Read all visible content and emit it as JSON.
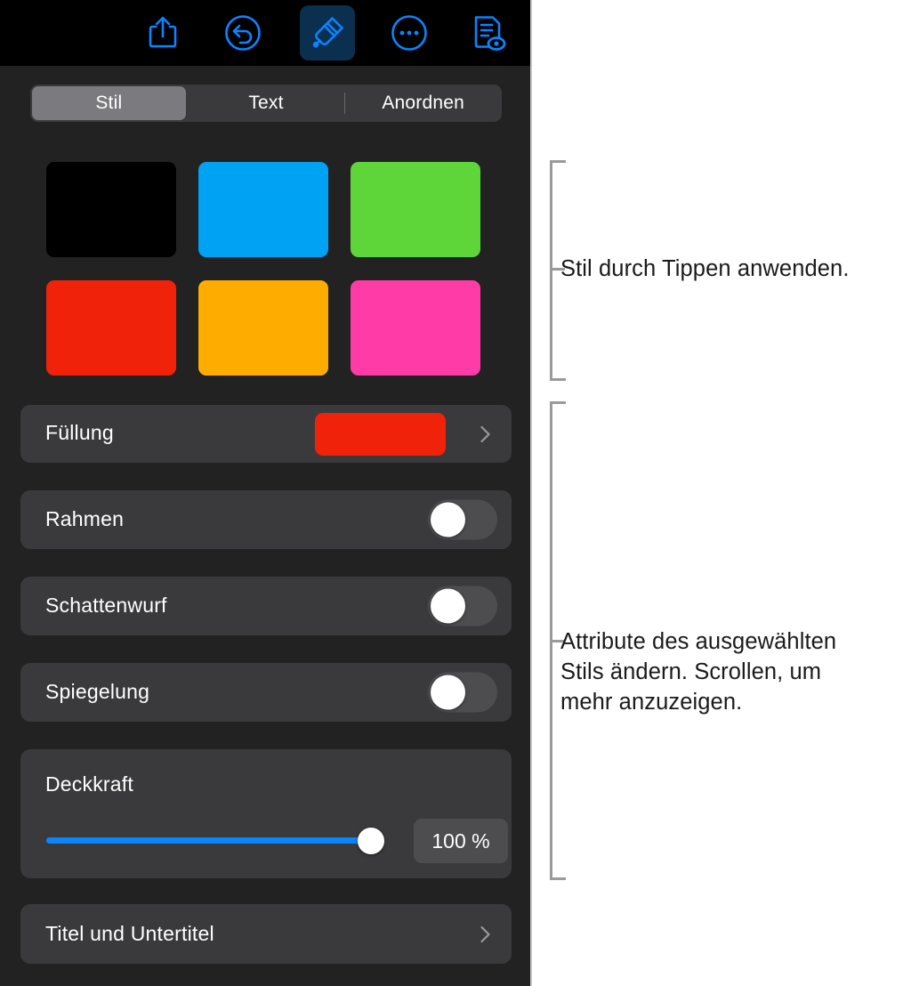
{
  "toolbar": {
    "items": [
      {
        "name": "share-icon",
        "label": "Teilen",
        "active": false
      },
      {
        "name": "undo-icon",
        "label": "Widerrufen",
        "active": false
      },
      {
        "name": "format-brush-icon",
        "label": "Format",
        "active": true
      },
      {
        "name": "more-options-icon",
        "label": "Mehr",
        "active": false
      },
      {
        "name": "document-preview-icon",
        "label": "Dokument",
        "active": false
      }
    ]
  },
  "segmented_control": {
    "tabs": [
      {
        "label": "Stil",
        "selected": true
      },
      {
        "label": "Text",
        "selected": false
      },
      {
        "label": "Anordnen",
        "selected": false
      }
    ]
  },
  "style_swatches": {
    "items": [
      {
        "name": "style-swatch-black",
        "color": "#000000"
      },
      {
        "name": "style-swatch-blue",
        "color": "#00a2f3"
      },
      {
        "name": "style-swatch-green",
        "color": "#5ed63a"
      },
      {
        "name": "style-swatch-red",
        "color": "#f02209"
      },
      {
        "name": "style-swatch-orange",
        "color": "#ffac00"
      },
      {
        "name": "style-swatch-pink",
        "color": "#ff3ba7"
      }
    ]
  },
  "rows": {
    "fill": {
      "label": "Füllung",
      "color": "#f02209"
    },
    "border": {
      "label": "Rahmen",
      "enabled": false
    },
    "shadow": {
      "label": "Schattenwurf",
      "enabled": false
    },
    "reflection": {
      "label": "Spiegelung",
      "enabled": false
    },
    "opacity": {
      "label": "Deckkraft",
      "value": "100 %",
      "percent": 100
    },
    "title_subtitle": {
      "label": "Titel und Untertitel"
    }
  },
  "callouts": {
    "top": "Stil durch Tippen anwenden.",
    "bottom": "Attribute des ausgewählten\nStils ändern. Scrollen, um\nmehr anzuzeigen."
  },
  "colors": {
    "panel_bg": "#222222",
    "toolbar_bg": "#000000",
    "row_bg": "#3a3a3c",
    "accent_blue": "#0a84ff",
    "toolbar_icon_blue": "#0a84ff",
    "text_white": "#ffffff",
    "callout_gray": "#9a9a9a"
  }
}
